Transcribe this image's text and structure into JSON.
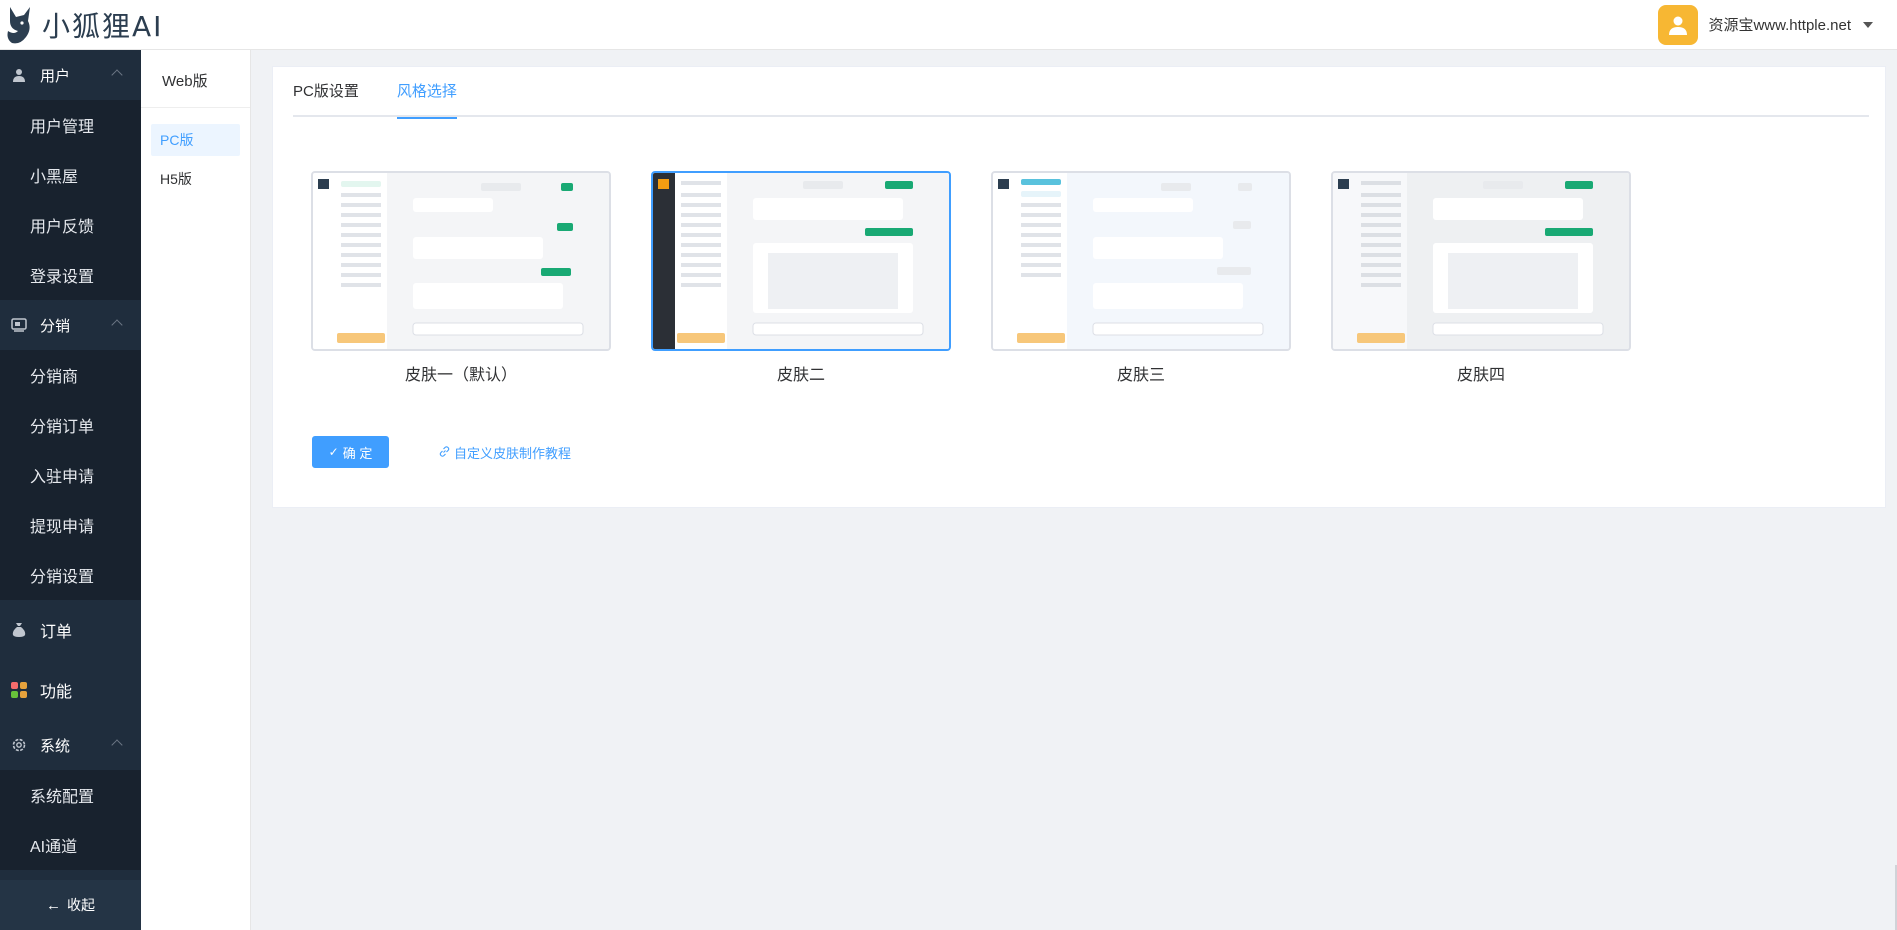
{
  "header": {
    "logo_text": "小狐狸AI",
    "user_name": "资源宝www.httple.net"
  },
  "sidebar": {
    "groups": [
      {
        "label": "用户",
        "items": [
          "用户管理",
          "小黑屋",
          "用户反馈",
          "登录设置"
        ]
      },
      {
        "label": "分销",
        "items": [
          "分销商",
          "分销订单",
          "入驻申请",
          "提现申请",
          "分销设置"
        ]
      },
      {
        "label": "订单",
        "items": []
      },
      {
        "label": "功能",
        "items": []
      },
      {
        "label": "系统",
        "items": [
          "系统配置",
          "AI通道"
        ]
      }
    ],
    "collapse_label": "收起"
  },
  "submenu": {
    "title": "Web版",
    "items": [
      "PC版",
      "H5版"
    ]
  },
  "main": {
    "tabs": [
      "PC版设置",
      "风格选择"
    ],
    "active_tab": 1,
    "skins": [
      {
        "label": "皮肤一（默认）",
        "selected": false
      },
      {
        "label": "皮肤二",
        "selected": true
      },
      {
        "label": "皮肤三",
        "selected": false
      },
      {
        "label": "皮肤四",
        "selected": false
      }
    ],
    "confirm_label": "确 定",
    "tutorial_link": "自定义皮肤制作教程"
  },
  "colors": {
    "accent": "#409eff",
    "sidebar_bg": "#1f2d3d",
    "sidebar_item_bg": "#18222e"
  }
}
